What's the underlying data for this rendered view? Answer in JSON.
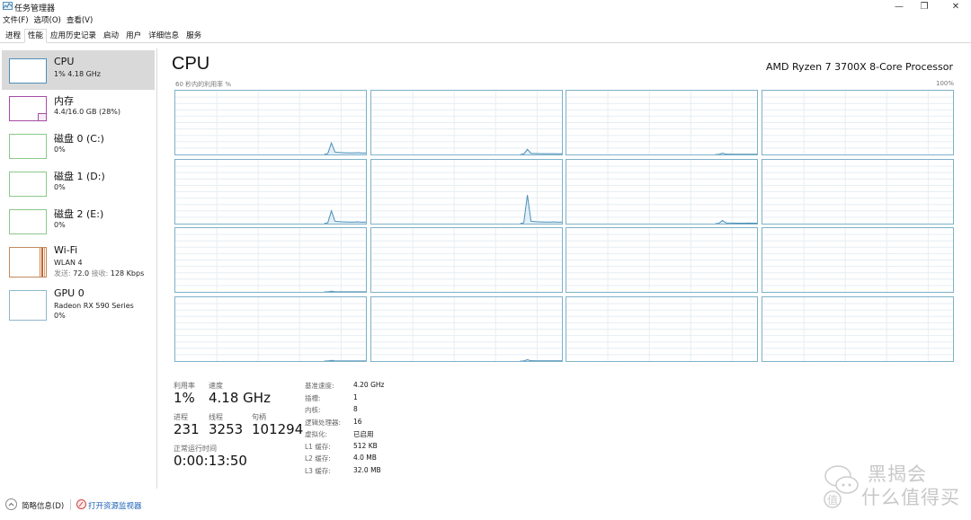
{
  "window": {
    "title": "任务管理器",
    "controls": {
      "minimize": "—",
      "maximize": "❐",
      "close": "✕"
    }
  },
  "menu": [
    "文件(F)",
    "选项(O)",
    "查看(V)"
  ],
  "tabs": [
    {
      "label": "进程",
      "active": false
    },
    {
      "label": "性能",
      "active": true
    },
    {
      "label": "应用历史记录",
      "active": false
    },
    {
      "label": "启动",
      "active": false
    },
    {
      "label": "用户",
      "active": false
    },
    {
      "label": "详细信息",
      "active": false
    },
    {
      "label": "服务",
      "active": false
    }
  ],
  "sidebar": {
    "items": [
      {
        "name": "CPU",
        "sub": "1% 4.18 GHz",
        "sub2": "",
        "color": "#4f8fba",
        "selected": true
      },
      {
        "name": "内存",
        "sub": "4.4/16.0 GB (28%)",
        "sub2": "",
        "color": "#a64ca6",
        "selected": false
      },
      {
        "name": "磁盘 0 (C:)",
        "sub": "0%",
        "sub2": "",
        "color": "#6cb86c",
        "selected": false
      },
      {
        "name": "磁盘 1 (D:)",
        "sub": "0%",
        "sub2": "",
        "color": "#6cb86c",
        "selected": false
      },
      {
        "name": "磁盘 2 (E:)",
        "sub": "0%",
        "sub2": "",
        "color": "#6cb86c",
        "selected": false
      },
      {
        "name": "Wi-Fi",
        "sub": "WLAN 4",
        "sub2_send_label": "发送:",
        "sub2_send": "72.0",
        "sub2_recv_label": "接收:",
        "sub2_recv": "128 Kbps",
        "color": "#a7582a",
        "selected": false
      },
      {
        "name": "GPU 0",
        "sub": "Radeon RX 590 Series",
        "sub2": "0%",
        "color": "#4f8fba",
        "selected": false
      }
    ]
  },
  "main": {
    "title": "CPU",
    "model": "AMD Ryzen 7 3700X 8-Core Processor",
    "graph_label": "60 秒内的利用率 %",
    "graph_max": "100%",
    "graph_line_color": "#4a90b8",
    "graph_border_color": "#7eb1c8",
    "core_peaks_percent": [
      18,
      8,
      2,
      0,
      20,
      45,
      5,
      0,
      1,
      0,
      0,
      0,
      1,
      2,
      0,
      0
    ]
  },
  "stats": {
    "utilization_label": "利用率",
    "utilization": "1%",
    "speed_label": "速度",
    "speed": "4.18 GHz",
    "processes_label": "进程",
    "processes": "231",
    "threads_label": "线程",
    "threads": "3253",
    "handles_label": "句柄",
    "handles": "101294",
    "uptime_label": "正常运行时间",
    "uptime": "0:00:13:50"
  },
  "specs": [
    {
      "key": "基准速度:",
      "value": "4.20 GHz"
    },
    {
      "key": "插槽:",
      "value": "1"
    },
    {
      "key": "内核:",
      "value": "8"
    },
    {
      "key": "逻辑处理器:",
      "value": "16"
    },
    {
      "key": "虚拟化:",
      "value": "已启用"
    },
    {
      "key": "L1 缓存:",
      "value": "512 KB"
    },
    {
      "key": "L2 缓存:",
      "value": "4.0 MB"
    },
    {
      "key": "L3 缓存:",
      "value": "32.0 MB"
    }
  ],
  "footer": {
    "fewer_details": "简略信息(D)",
    "resource_monitor": "打开资源监视器"
  },
  "watermark": {
    "line1": "黑揭会",
    "line2": "什么值得买",
    "badge": "值"
  }
}
